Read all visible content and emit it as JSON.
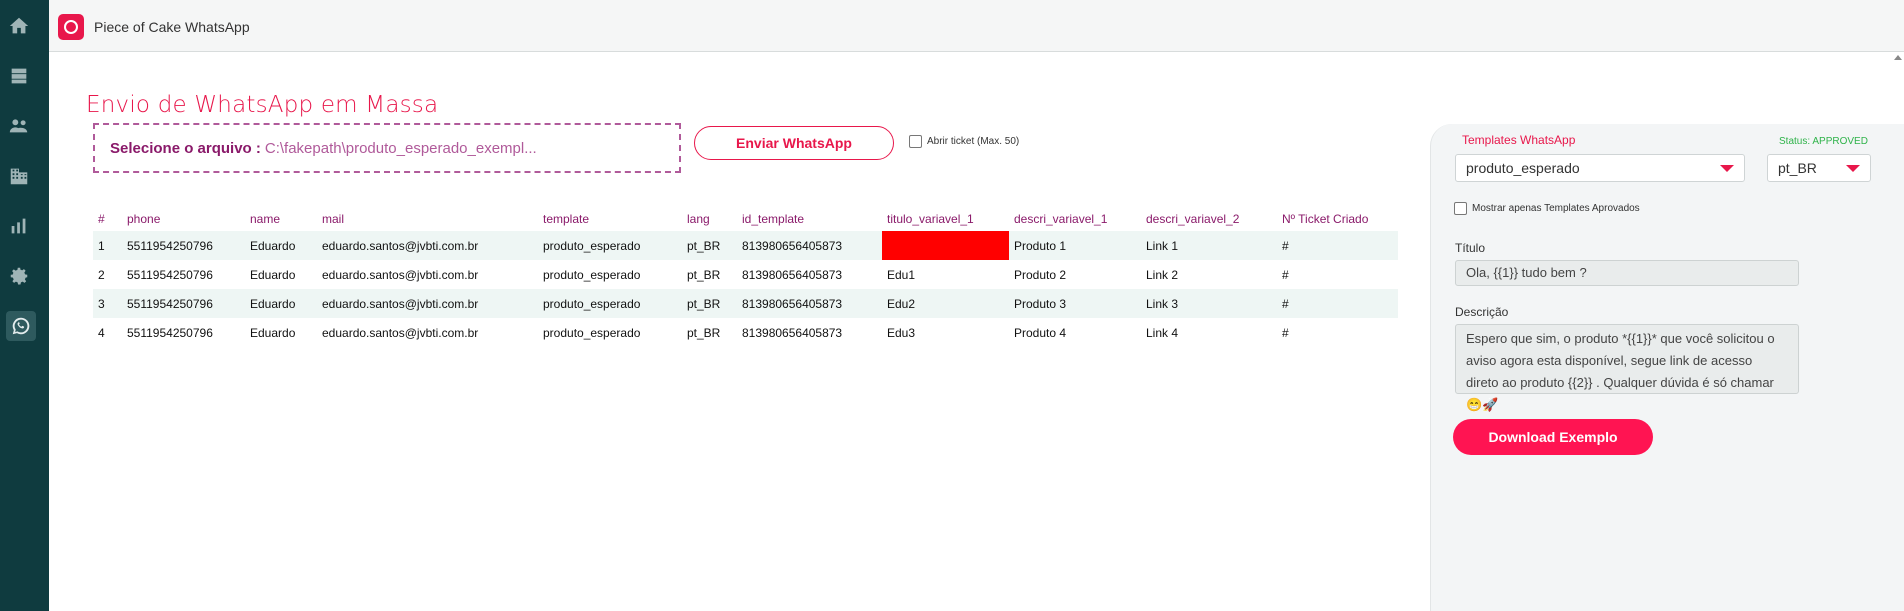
{
  "app": {
    "title": "Piece of Cake WhatsApp"
  },
  "rail": {
    "items": [
      {
        "icon": "home-icon"
      },
      {
        "icon": "database-icon"
      },
      {
        "icon": "users-icon"
      },
      {
        "icon": "building-icon"
      },
      {
        "icon": "chart-icon"
      },
      {
        "icon": "gear-icon"
      },
      {
        "icon": "whatsapp-icon",
        "active": true
      }
    ]
  },
  "page": {
    "title": "Envio de WhatsApp em Massa"
  },
  "upload": {
    "label": "Selecione o arquivo :",
    "path": "C:\\fakepath\\produto_esperado_exempl..."
  },
  "actions": {
    "send_label": "Enviar WhatsApp",
    "ticket_label": "Abrir ticket (Max. 50)"
  },
  "table": {
    "headers": [
      "#",
      "phone",
      "name",
      "mail",
      "template",
      "lang",
      "id_template",
      "titulo_variavel_1",
      "descri_variavel_1",
      "descri_variavel_2",
      "Nº Ticket Criado"
    ],
    "rows": [
      [
        "1",
        "5511954250796",
        "Eduardo",
        "eduardo.santos@jvbti.com.br",
        "produto_esperado",
        "pt_BR",
        "813980656405873",
        "",
        "Produto 1",
        "Link 1",
        "#"
      ],
      [
        "2",
        "5511954250796",
        "Eduardo",
        "eduardo.santos@jvbti.com.br",
        "produto_esperado",
        "pt_BR",
        "813980656405873",
        "Edu1",
        "Produto 2",
        "Link 2",
        "#"
      ],
      [
        "3",
        "5511954250796",
        "Eduardo",
        "eduardo.santos@jvbti.com.br",
        "produto_esperado",
        "pt_BR",
        "813980656405873",
        "Edu2",
        "Produto 3",
        "Link 3",
        "#"
      ],
      [
        "4",
        "5511954250796",
        "Eduardo",
        "eduardo.santos@jvbti.com.br",
        "produto_esperado",
        "pt_BR",
        "813980656405873",
        "Edu3",
        "Produto 4",
        "Link 4",
        "#"
      ]
    ],
    "error_cell_color": "#ff0000"
  },
  "panel": {
    "templates_label": "Templates WhatsApp",
    "status": "Status: APPROVED",
    "template_value": "produto_esperado",
    "lang_value": "pt_BR",
    "approved_only_label": "Mostrar apenas Templates Aprovados",
    "titulo_label": "Título",
    "titulo_value": "Ola, {{1}} tudo bem ?",
    "descricao_label": "Descrição",
    "descricao_value": "Espero que sim, o produto *{{1}}* que você solicitou o aviso agora esta disponível, segue link de acesso direto ao produto {{2}} . Qualquer dúvida é só chamar 😁🚀",
    "download_label": "Download Exemplo"
  },
  "colors": {
    "accent": "#e8174b",
    "rail": "#0f3b3f",
    "header_text": "#8a1a6a",
    "status_ok": "#2fb34a"
  }
}
